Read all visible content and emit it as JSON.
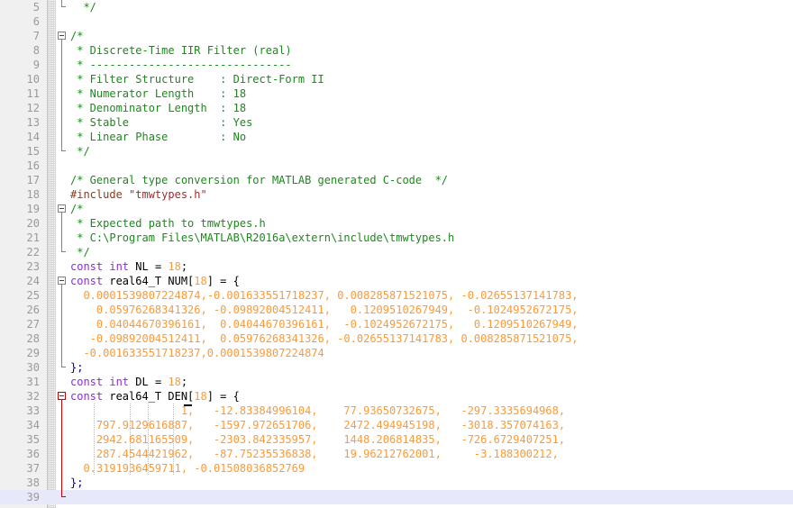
{
  "editor": {
    "title": "Discrete-Time IIR Filter C source",
    "language": "c",
    "current_line": 39,
    "first_visible_line": 5,
    "last_visible_line": 39,
    "colors": {
      "background": "#ffffff",
      "gutter_background": "#f0f0f0",
      "line_number": "#9a9a9a",
      "comment": "#1a8a1a",
      "keyword": "#8a2be2",
      "number": "#ff9933",
      "preprocessor": "#8b3a1a",
      "string": "#a52a2a",
      "operator": "#000080",
      "plain_text": "#000000",
      "current_line_highlight": "#e8e8fb",
      "fold_marker": "#808080",
      "fold_marker_active": "#cc0000"
    },
    "lines": [
      {
        "number": 5,
        "fold": "end",
        "fold_color": "gray",
        "guides": [],
        "tokens": [
          {
            "text": "  ",
            "type": "plain"
          },
          {
            "text": "*/",
            "type": "comment"
          }
        ]
      },
      {
        "number": 6,
        "fold": "none",
        "fold_color": "gray",
        "guides": [],
        "tokens": []
      },
      {
        "number": 7,
        "fold": "start",
        "fold_color": "gray",
        "guides": [],
        "tokens": [
          {
            "text": "/*",
            "type": "comment"
          }
        ]
      },
      {
        "number": 8,
        "fold": "line",
        "fold_color": "gray",
        "guides": [],
        "tokens": [
          {
            "text": " * Discrete-Time IIR Filter (real)",
            "type": "comment"
          }
        ]
      },
      {
        "number": 9,
        "fold": "line",
        "fold_color": "gray",
        "guides": [],
        "tokens": [
          {
            "text": " * -------------------------------",
            "type": "comment"
          }
        ]
      },
      {
        "number": 10,
        "fold": "line",
        "fold_color": "gray",
        "guides": [],
        "tokens": [
          {
            "text": " * Filter Structure    : Direct-Form II",
            "type": "comment"
          }
        ]
      },
      {
        "number": 11,
        "fold": "line",
        "fold_color": "gray",
        "guides": [],
        "tokens": [
          {
            "text": " * Numerator Length    : 18",
            "type": "comment"
          }
        ]
      },
      {
        "number": 12,
        "fold": "line",
        "fold_color": "gray",
        "guides": [],
        "tokens": [
          {
            "text": " * Denominator Length  : 18",
            "type": "comment"
          }
        ]
      },
      {
        "number": 13,
        "fold": "line",
        "fold_color": "gray",
        "guides": [],
        "tokens": [
          {
            "text": " * Stable              : Yes",
            "type": "comment"
          }
        ]
      },
      {
        "number": 14,
        "fold": "line",
        "fold_color": "gray",
        "guides": [],
        "tokens": [
          {
            "text": " * Linear Phase        : No",
            "type": "comment"
          }
        ]
      },
      {
        "number": 15,
        "fold": "end",
        "fold_color": "gray",
        "guides": [],
        "tokens": [
          {
            "text": " */",
            "type": "comment"
          }
        ]
      },
      {
        "number": 16,
        "fold": "none",
        "fold_color": "gray",
        "guides": [],
        "tokens": []
      },
      {
        "number": 17,
        "fold": "none",
        "fold_color": "gray",
        "guides": [],
        "tokens": [
          {
            "text": "/* General type conversion for MATLAB generated C-code  */",
            "type": "comment"
          }
        ]
      },
      {
        "number": 18,
        "fold": "none",
        "fold_color": "gray",
        "guides": [],
        "tokens": [
          {
            "text": "#include ",
            "type": "preprocessor"
          },
          {
            "text": "\"tmwtypes.h\"",
            "type": "string"
          }
        ]
      },
      {
        "number": 19,
        "fold": "start",
        "fold_color": "gray",
        "guides": [],
        "tokens": [
          {
            "text": "/*",
            "type": "comment"
          }
        ]
      },
      {
        "number": 20,
        "fold": "line",
        "fold_color": "gray",
        "guides": [],
        "tokens": [
          {
            "text": " * Expected path to tmwtypes.h",
            "type": "comment"
          }
        ]
      },
      {
        "number": 21,
        "fold": "line",
        "fold_color": "gray",
        "guides": [],
        "tokens": [
          {
            "text": " * C:\\Program Files\\MATLAB\\R2016a\\extern\\include\\tmwtypes.h",
            "type": "comment"
          }
        ]
      },
      {
        "number": 22,
        "fold": "end",
        "fold_color": "gray",
        "guides": [],
        "tokens": [
          {
            "text": " */",
            "type": "comment"
          }
        ]
      },
      {
        "number": 23,
        "fold": "none",
        "fold_color": "gray",
        "guides": [],
        "tokens": [
          {
            "text": "const",
            "type": "keyword"
          },
          {
            "text": " ",
            "type": "plain"
          },
          {
            "text": "int",
            "type": "keyword"
          },
          {
            "text": " NL = ",
            "type": "plain"
          },
          {
            "text": "18",
            "type": "number"
          },
          {
            "text": ";",
            "type": "plain"
          }
        ]
      },
      {
        "number": 24,
        "fold": "start",
        "fold_color": "gray",
        "guides": [],
        "tokens": [
          {
            "text": "const",
            "type": "keyword"
          },
          {
            "text": " real64_T NUM[",
            "type": "plain"
          },
          {
            "text": "18",
            "type": "number"
          },
          {
            "text": "] = {",
            "type": "plain"
          }
        ]
      },
      {
        "number": 25,
        "fold": "line",
        "fold_color": "gray",
        "guides": [],
        "tokens": [
          {
            "text": "  0.0001539807224874,-0.001633551718237, 0.008285871521075, -0.02655137141783,",
            "type": "number"
          }
        ]
      },
      {
        "number": 26,
        "fold": "line",
        "fold_color": "gray",
        "guides": [],
        "tokens": [
          {
            "text": "    0.05976268341326, -0.09892004512411,   0.1209510267949,  -0.1024952672175,",
            "type": "number"
          }
        ]
      },
      {
        "number": 27,
        "fold": "line",
        "fold_color": "gray",
        "guides": [],
        "tokens": [
          {
            "text": "    0.04044670396161,  0.04044670396161,  -0.1024952672175,   0.1209510267949,",
            "type": "number"
          }
        ]
      },
      {
        "number": 28,
        "fold": "line",
        "fold_color": "gray",
        "guides": [],
        "tokens": [
          {
            "text": "   -0.09892004512411,  0.05976268341326, -0.02655137141783, 0.008285871521075,",
            "type": "number"
          }
        ]
      },
      {
        "number": 29,
        "fold": "line",
        "fold_color": "gray",
        "guides": [],
        "tokens": [
          {
            "text": "  -0.001633551718237,0.0001539807224874",
            "type": "number"
          }
        ]
      },
      {
        "number": 30,
        "fold": "end",
        "fold_color": "gray",
        "guides": [],
        "tokens": [
          {
            "text": "};",
            "type": "operator"
          }
        ]
      },
      {
        "number": 31,
        "fold": "none",
        "fold_color": "gray",
        "guides": [],
        "tokens": [
          {
            "text": "const",
            "type": "keyword"
          },
          {
            "text": " ",
            "type": "plain"
          },
          {
            "text": "int",
            "type": "keyword"
          },
          {
            "text": " DL = ",
            "type": "plain"
          },
          {
            "text": "18",
            "type": "number"
          },
          {
            "text": ";",
            "type": "plain"
          }
        ]
      },
      {
        "number": 32,
        "fold": "start",
        "fold_color": "red",
        "guides": [],
        "tokens": [
          {
            "text": "const",
            "type": "keyword"
          },
          {
            "text": " real64_T DEN[",
            "type": "plain"
          },
          {
            "text": "18",
            "type": "number"
          },
          {
            "text": "] = {",
            "type": "plain"
          }
        ]
      },
      {
        "number": 33,
        "fold": "line",
        "fold_color": "red",
        "guides": [
          26,
          66,
          86,
          114
        ],
        "bracket_mark": 126,
        "tokens": [
          {
            "text": "                 1,   -12.83384996104,    77.93650732675,   -297.3335694968,",
            "type": "number"
          }
        ]
      },
      {
        "number": 34,
        "fold": "line",
        "fold_color": "red",
        "guides": [
          26,
          66,
          86,
          114
        ],
        "tokens": [
          {
            "text": "    797.9129616887,   -1597.972651706,    2472.494945198,   -3018.357074163,",
            "type": "number"
          }
        ]
      },
      {
        "number": 35,
        "fold": "line",
        "fold_color": "red",
        "guides": [
          26,
          66,
          86,
          114
        ],
        "tokens": [
          {
            "text": "    2942.681165509,   -2303.842335957,    1448.206814835,   -726.6729407251,",
            "type": "number"
          }
        ]
      },
      {
        "number": 36,
        "fold": "line",
        "fold_color": "red",
        "guides": [
          26,
          66,
          86,
          114
        ],
        "tokens": [
          {
            "text": "    287.4544421962,   -87.75235536838,    19.96212762001,     -3.188300212,",
            "type": "number"
          }
        ]
      },
      {
        "number": 37,
        "fold": "line",
        "fold_color": "red",
        "guides": [
          26,
          66,
          86,
          114
        ],
        "tokens": [
          {
            "text": "  0.3191936459711, -0.01508036852769",
            "type": "number"
          }
        ]
      },
      {
        "number": 38,
        "fold": "line",
        "fold_color": "red",
        "guides": [],
        "tokens": [
          {
            "text": "};",
            "type": "operator"
          }
        ]
      },
      {
        "number": 39,
        "fold": "end",
        "fold_color": "red",
        "guides": [],
        "current": true,
        "tokens": []
      }
    ]
  }
}
